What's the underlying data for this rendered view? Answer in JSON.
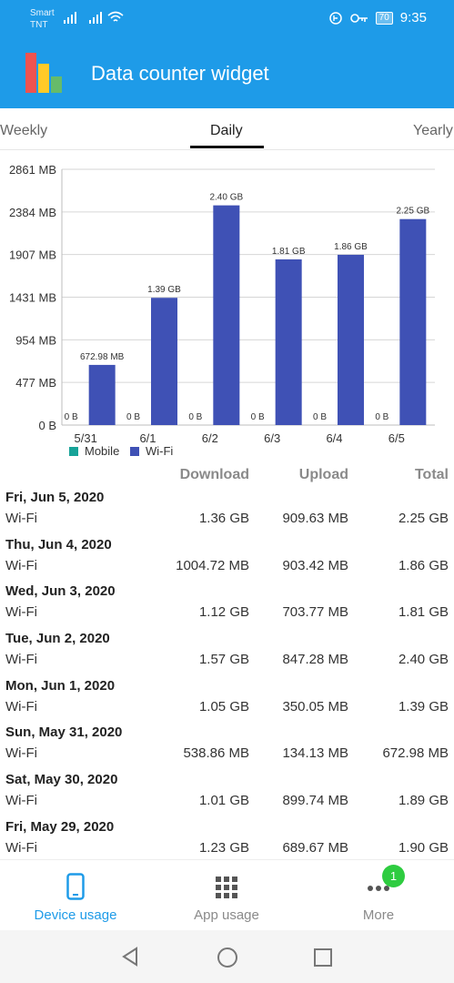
{
  "status_bar": {
    "carrier_line1": "Smart",
    "carrier_line2": "TNT",
    "battery": "70",
    "time": "9:35"
  },
  "app": {
    "title": "Data counter widget"
  },
  "tabs": [
    {
      "label": "Weekly",
      "active": false
    },
    {
      "label": "Daily",
      "active": true
    },
    {
      "label": "Yearly",
      "active": false
    }
  ],
  "chart_data": {
    "type": "bar",
    "categories": [
      "5/31",
      "6/1",
      "6/2",
      "6/3",
      "6/4",
      "6/5"
    ],
    "series": [
      {
        "name": "Mobile",
        "color": "#17a398",
        "values": [
          0,
          0,
          0,
          0,
          0,
          0
        ],
        "labels": [
          "0 B",
          "0 B",
          "0 B",
          "0 B",
          "0 B",
          "0 B"
        ]
      },
      {
        "name": "Wi-Fi",
        "color": "#3f51b5",
        "values": [
          672.98,
          1423.36,
          2457.6,
          1853.44,
          1904.64,
          2304.0
        ],
        "labels": [
          "672.98 MB",
          "1.39 GB",
          "2.40 GB",
          "1.81 GB",
          "1.86 GB",
          "2.25 GB"
        ]
      }
    ],
    "y_ticks": [
      "0 B",
      "477 MB",
      "954 MB",
      "1431 MB",
      "1907 MB",
      "2384 MB",
      "2861 MB"
    ],
    "ylim": [
      0,
      2861
    ],
    "grid": true,
    "legend": "bottom-left"
  },
  "table": {
    "headers": {
      "download": "Download",
      "upload": "Upload",
      "total": "Total"
    },
    "days": [
      {
        "date": "Fri, Jun 5, 2020",
        "network": "Wi-Fi",
        "download": "1.36 GB",
        "upload": "909.63 MB",
        "total": "2.25 GB"
      },
      {
        "date": "Thu, Jun 4, 2020",
        "network": "Wi-Fi",
        "download": "1004.72 MB",
        "upload": "903.42 MB",
        "total": "1.86 GB"
      },
      {
        "date": "Wed, Jun 3, 2020",
        "network": "Wi-Fi",
        "download": "1.12 GB",
        "upload": "703.77 MB",
        "total": "1.81 GB"
      },
      {
        "date": "Tue, Jun 2, 2020",
        "network": "Wi-Fi",
        "download": "1.57 GB",
        "upload": "847.28 MB",
        "total": "2.40 GB"
      },
      {
        "date": "Mon, Jun 1, 2020",
        "network": "Wi-Fi",
        "download": "1.05 GB",
        "upload": "350.05 MB",
        "total": "1.39 GB"
      },
      {
        "date": "Sun, May 31, 2020",
        "network": "Wi-Fi",
        "download": "538.86 MB",
        "upload": "134.13 MB",
        "total": "672.98 MB"
      },
      {
        "date": "Sat, May 30, 2020",
        "network": "Wi-Fi",
        "download": "1.01 GB",
        "upload": "899.74 MB",
        "total": "1.89 GB"
      },
      {
        "date": "Fri, May 29, 2020",
        "network": "Wi-Fi",
        "download": "1.23 GB",
        "upload": "689.67 MB",
        "total": "1.90 GB"
      }
    ]
  },
  "bottom_nav": {
    "items": [
      {
        "label": "Device usage",
        "icon": "phone-icon",
        "active": true
      },
      {
        "label": "App usage",
        "icon": "grid-icon",
        "active": false
      },
      {
        "label": "More",
        "icon": "more-dots-icon",
        "active": false
      }
    ],
    "more_badge": "1"
  },
  "colors": {
    "primary": "#1e9be8",
    "wifi": "#3f51b5",
    "mobile": "#17a398",
    "badge": "#2ecc40"
  }
}
